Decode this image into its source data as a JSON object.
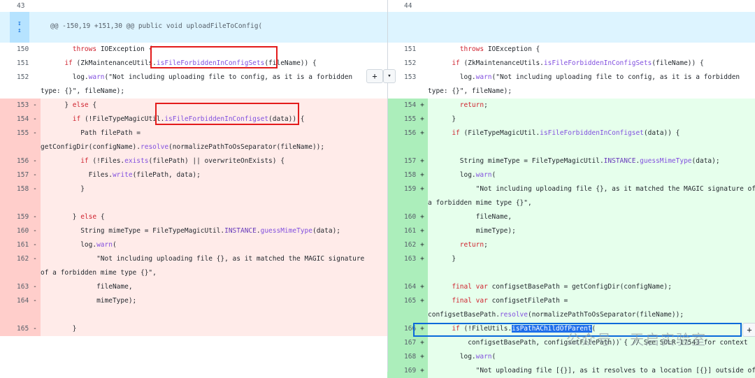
{
  "top": {
    "left_num": "43",
    "right_num": "44"
  },
  "hunk": {
    "expand_up_icon": "↧",
    "expand_down_icon": "↥",
    "header": "@@ -150,19 +151,30 @@ public void uploadFileToConfig("
  },
  "left_rows": [
    {
      "n": "150",
      "m": "",
      "t": "ctx",
      "c": "        throws IOException {"
    },
    {
      "n": "151",
      "m": "",
      "t": "ctx",
      "c": "      if (ZkMaintenanceUtils.isFileForbiddenInConfigSets(fileName)) {"
    },
    {
      "n": "152",
      "m": "",
      "t": "ctx",
      "c": "        log.warn(\"Not including uploading file to config, as it is a forbidden",
      "c2": "type: {}\", fileName);"
    },
    {
      "n": "153",
      "m": "-",
      "t": "del",
      "c": "      } else {"
    },
    {
      "n": "154",
      "m": "-",
      "t": "del",
      "c": "        if (!FileTypeMagicUtil.isFileForbiddenInConfigset(data)) {"
    },
    {
      "n": "155",
      "m": "-",
      "t": "del",
      "c": "          Path filePath =",
      "c2": "getConfigDir(configName).resolve(normalizePathToOsSeparator(fileName));"
    },
    {
      "n": "156",
      "m": "-",
      "t": "del",
      "c": "          if (!Files.exists(filePath) || overwriteOnExists) {"
    },
    {
      "n": "157",
      "m": "-",
      "t": "del",
      "c": "            Files.write(filePath, data);"
    },
    {
      "n": "158",
      "m": "-",
      "t": "del",
      "c": "          }"
    },
    {
      "n": "",
      "m": "",
      "t": "del",
      "c": ""
    },
    {
      "n": "159",
      "m": "-",
      "t": "del",
      "c": "        } else {"
    },
    {
      "n": "160",
      "m": "-",
      "t": "del",
      "c": "          String mimeType = FileTypeMagicUtil.INSTANCE.guessMimeType(data);"
    },
    {
      "n": "161",
      "m": "-",
      "t": "del",
      "c": "          log.warn("
    },
    {
      "n": "162",
      "m": "-",
      "t": "del",
      "c": "              \"Not including uploading file {}, as it matched the MAGIC signature",
      "c2": "of a forbidden mime type {}\","
    },
    {
      "n": "163",
      "m": "-",
      "t": "del",
      "c": "              fileName,"
    },
    {
      "n": "164",
      "m": "-",
      "t": "del",
      "c": "              mimeType);"
    },
    {
      "n": "",
      "m": "",
      "t": "del",
      "c": ""
    },
    {
      "n": "165",
      "m": "-",
      "t": "del",
      "c": "        }"
    }
  ],
  "right_rows": [
    {
      "n": "151",
      "m": "",
      "t": "ctx",
      "c": "        throws IOException {"
    },
    {
      "n": "152",
      "m": "",
      "t": "ctx",
      "c": "      if (ZkMaintenanceUtils.isFileForbiddenInConfigSets(fileName)) {"
    },
    {
      "n": "153",
      "m": "",
      "t": "ctx",
      "c": "        log.warn(\"Not including uploading file to config, as it is a forbidden",
      "c2": "type: {}\", fileName);"
    },
    {
      "n": "154",
      "m": "+",
      "t": "add",
      "c": "        return;"
    },
    {
      "n": "155",
      "m": "+",
      "t": "add",
      "c": "      }"
    },
    {
      "n": "156",
      "m": "+",
      "t": "add",
      "c": "      if (FileTypeMagicUtil.isFileForbiddenInConfigset(data)) {"
    },
    {
      "n": "",
      "m": "",
      "t": "add",
      "c": ""
    },
    {
      "n": "157",
      "m": "+",
      "t": "add",
      "c": "        String mimeType = FileTypeMagicUtil.INSTANCE.guessMimeType(data);"
    },
    {
      "n": "158",
      "m": "+",
      "t": "add",
      "c": "        log.warn("
    },
    {
      "n": "159",
      "m": "+",
      "t": "add",
      "c": "            \"Not including uploading file {}, as it matched the MAGIC signature of",
      "c2": "a forbidden mime type {}\","
    },
    {
      "n": "160",
      "m": "+",
      "t": "add",
      "c": "            fileName,"
    },
    {
      "n": "161",
      "m": "+",
      "t": "add",
      "c": "            mimeType);"
    },
    {
      "n": "162",
      "m": "+",
      "t": "add",
      "c": "        return;"
    },
    {
      "n": "163",
      "m": "+",
      "t": "add",
      "c": "      }"
    },
    {
      "n": "",
      "m": "",
      "t": "add",
      "c": ""
    },
    {
      "n": "164",
      "m": "+",
      "t": "add",
      "c": "      final var configsetBasePath = getConfigDir(configName);"
    },
    {
      "n": "165",
      "m": "+",
      "t": "add",
      "c": "      final var configsetFilePath =",
      "c2": "configsetBasePath.resolve(normalizePathToOsSeparator(fileName));"
    },
    {
      "n": "166",
      "m": "+",
      "t": "add",
      "c": "      if (!FileUtils.isPathAChildOfParent("
    },
    {
      "n": "167",
      "m": "+",
      "t": "add",
      "c": "          configsetBasePath, configsetFilePath)) { // See SOLR-17543 for context"
    },
    {
      "n": "168",
      "m": "+",
      "t": "add",
      "c": "        log.warn("
    },
    {
      "n": "169",
      "m": "+",
      "t": "add",
      "c": "            \"Not uploading file [{}], as it resolves to a location [{}] outside of"
    }
  ],
  "buttons": {
    "plus": "+",
    "dropdown": "▾"
  },
  "watermark": "公众号 · 天启实验室",
  "colors": {
    "del": "#ffebe9",
    "add": "#e6ffec",
    "hunk": "#ddf4ff",
    "highlight_box": "#e31b1b"
  }
}
